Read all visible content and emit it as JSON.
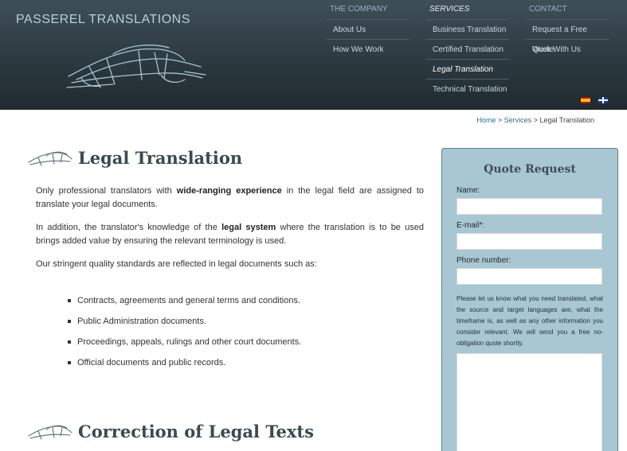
{
  "brand": "PASSEREL TRANSLATIONS",
  "nav": [
    {
      "heading": "THE COMPANY",
      "active": false,
      "items": [
        {
          "label": "About Us",
          "active": false
        },
        {
          "label": "How We Work",
          "active": false
        }
      ]
    },
    {
      "heading": "SERVICES",
      "active": true,
      "items": [
        {
          "label": "Business Translation",
          "active": false
        },
        {
          "label": "Certified Translation",
          "active": false
        },
        {
          "label": "Legal Translation",
          "active": true
        },
        {
          "label": "Technical Translation",
          "active": false
        }
      ]
    },
    {
      "heading": "CONTACT",
      "active": false,
      "items": [
        {
          "label": "Request a Free Quote",
          "active": false
        },
        {
          "label": "Work With Us",
          "active": false
        }
      ]
    }
  ],
  "breadcrumb": {
    "home": "Home",
    "sep1": " > ",
    "services": "Services",
    "sep2": " > ",
    "current": "Legal Translation"
  },
  "main": {
    "title": "Legal Translation",
    "p1": {
      "a": "Only professional translators with ",
      "b": "wide-ranging experience",
      "c": " in the legal field are assigned to translate your legal documents."
    },
    "p2": {
      "a": "In addition, the translator's knowledge of the ",
      "b": "legal system",
      "c": " where the translation is to be used brings added value by ensuring the relevant terminology is used."
    },
    "p3": "Our stringent quality standards are reflected in legal documents such as:",
    "list": [
      "Contracts, agreements and general terms and conditions.",
      "Public Administration documents.",
      "Proceedings, appeals, rulings and other court documents.",
      "Official documents and public records."
    ],
    "title2": "Correction of Legal Texts"
  },
  "quote": {
    "title": "Quote Request",
    "name_label": "Name:",
    "email_label": "E-mail*:",
    "phone_label": "Phone number:",
    "note": "Please let us know what you need translated, what the source and target languages are, what the timeframe is, as well as any other information you consider relevant. We will send you a free no- obligation quote shortly."
  },
  "colors": {
    "header": "#2c3a41",
    "nav_heading": "#8fb7c6",
    "quote_bg": "#a9c7d2",
    "title": "#3a4a53"
  },
  "icons": [
    "spanish-flag-icon",
    "english-flag-icon",
    "car-sketch-logo",
    "car-sketch-bullet-icon"
  ]
}
